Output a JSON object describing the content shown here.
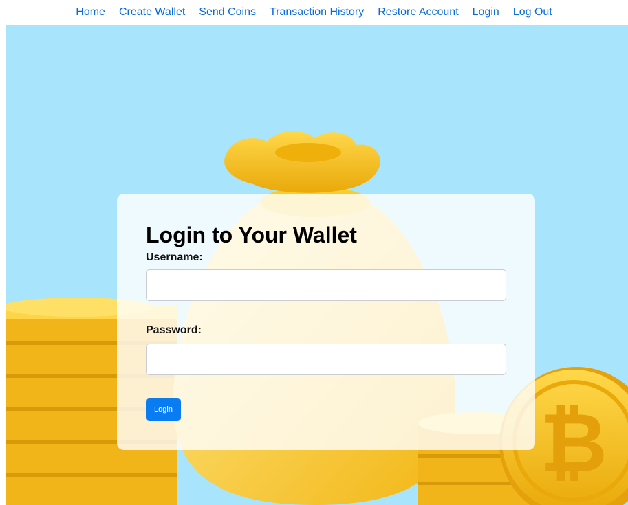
{
  "nav": {
    "items": [
      {
        "label": "Home"
      },
      {
        "label": "Create Wallet"
      },
      {
        "label": "Send Coins"
      },
      {
        "label": "Transaction History"
      },
      {
        "label": "Restore Account"
      },
      {
        "label": "Login"
      },
      {
        "label": "Log Out"
      }
    ]
  },
  "login": {
    "title": "Login to Your Wallet",
    "username_label": "Username:",
    "username_value": "",
    "username_placeholder": "",
    "password_label": "Password:",
    "password_value": "",
    "password_placeholder": "",
    "submit_label": "Login"
  },
  "background": {
    "illustration": "money-bag-and-bitcoin-coins",
    "icon": "bitcoin-icon"
  },
  "colors": {
    "nav_link": "#0a6bd6",
    "hero_background": "#a8e4fb",
    "button": "#0a7cf2",
    "gold": "#f5c518"
  }
}
